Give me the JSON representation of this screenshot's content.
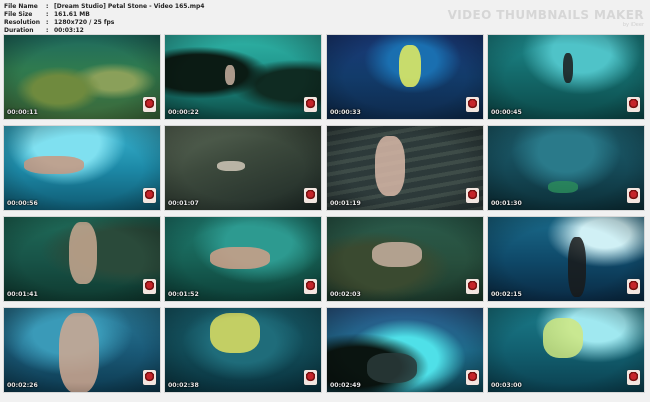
{
  "meta": {
    "rows": [
      {
        "key": "File Name",
        "value": "[Dream Studio] Petal Stone - Video 165.mp4"
      },
      {
        "key": "File Size",
        "value": "161.61 MB"
      },
      {
        "key": "Resolution",
        "value": "1280x720 / 25 fps"
      },
      {
        "key": "Duration",
        "value": "00:03:12"
      }
    ]
  },
  "brand": {
    "title": "VIDEO THUMBNAILS MAKER",
    "subtitle": "by iDeer"
  },
  "thumbnails": [
    {
      "time": "00:00:11",
      "icon": "studio-logo-icon"
    },
    {
      "time": "00:00:22",
      "icon": "studio-logo-icon"
    },
    {
      "time": "00:00:33",
      "icon": "studio-logo-icon"
    },
    {
      "time": "00:00:45",
      "icon": "studio-logo-icon"
    },
    {
      "time": "00:00:56",
      "icon": "studio-logo-icon"
    },
    {
      "time": "00:01:07",
      "icon": "studio-logo-icon"
    },
    {
      "time": "00:01:19",
      "icon": "studio-logo-icon"
    },
    {
      "time": "00:01:30",
      "icon": "studio-logo-icon"
    },
    {
      "time": "00:01:41",
      "icon": "studio-logo-icon"
    },
    {
      "time": "00:01:52",
      "icon": "studio-logo-icon"
    },
    {
      "time": "00:02:03",
      "icon": "studio-logo-icon"
    },
    {
      "time": "00:02:15",
      "icon": "studio-logo-icon"
    },
    {
      "time": "00:02:26",
      "icon": "studio-logo-icon"
    },
    {
      "time": "00:02:38",
      "icon": "studio-logo-icon"
    },
    {
      "time": "00:02:49",
      "icon": "studio-logo-icon"
    },
    {
      "time": "00:03:00",
      "icon": "studio-logo-icon"
    }
  ]
}
